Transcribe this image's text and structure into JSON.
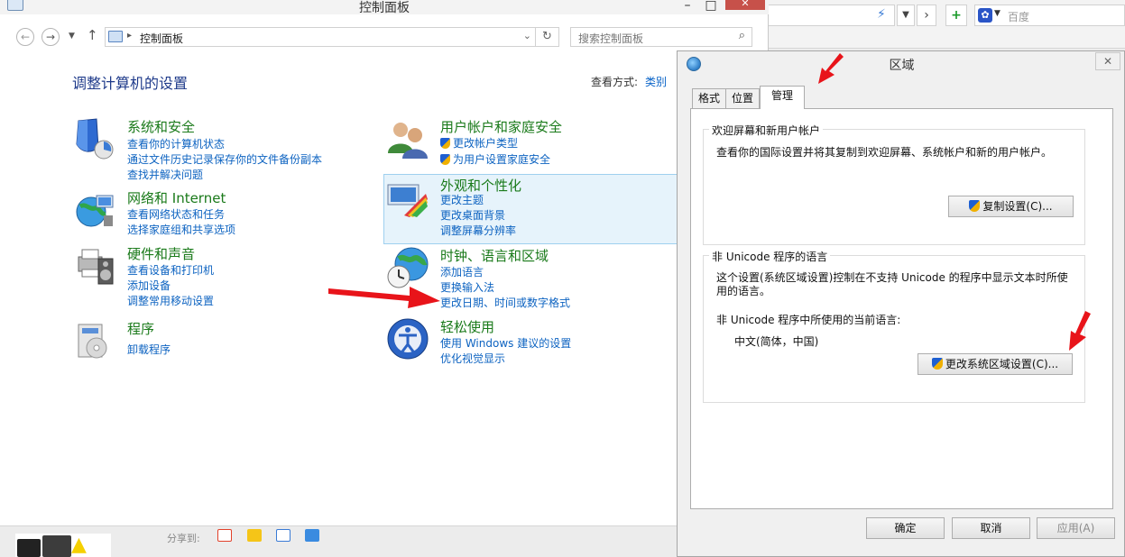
{
  "control_panel": {
    "title": "控制面板",
    "address": {
      "crumb": "控制面板",
      "separator": "▸"
    },
    "search_placeholder": "搜索控制面板",
    "heading": "调整计算机的设置",
    "view_by": {
      "label": "查看方式:",
      "value": "类别"
    },
    "categories": [
      {
        "title": "系统和安全",
        "links": [
          "查看你的计算机状态",
          "通过文件历史记录保存你的文件备份副本",
          "查找并解决问题"
        ]
      },
      {
        "title": "网络和 Internet",
        "links": [
          "查看网络状态和任务",
          "选择家庭组和共享选项"
        ]
      },
      {
        "title": "硬件和声音",
        "links": [
          "查看设备和打印机",
          "添加设备",
          "调整常用移动设置"
        ]
      },
      {
        "title": "程序",
        "links": [
          "卸载程序"
        ]
      },
      {
        "title": "用户帐户和家庭安全",
        "links": [
          "更改帐户类型",
          "为用户设置家庭安全"
        ]
      },
      {
        "title": "外观和个性化",
        "links": [
          "更改主题",
          "更改桌面背景",
          "调整屏幕分辨率"
        ]
      },
      {
        "title": "时钟、语言和区域",
        "links": [
          "添加语言",
          "更换输入法",
          "更改日期、时间或数字格式"
        ]
      },
      {
        "title": "轻松使用",
        "links": [
          "使用 Windows 建议的设置",
          "优化视觉显示"
        ]
      }
    ],
    "share_label": "分享到:"
  },
  "browser": {
    "search_placeholder": "百度"
  },
  "region_dialog": {
    "title": "区域",
    "tabs": [
      "格式",
      "位置",
      "管理"
    ],
    "active_tab": "管理",
    "welcome_group": {
      "label": "欢迎屏幕和新用户帐户",
      "text": "查看你的国际设置并将其复制到欢迎屏幕、系统帐户和新的用户帐户。",
      "button": "复制设置(C)..."
    },
    "unicode_group": {
      "label": "非 Unicode 程序的语言",
      "text_line1": "这个设置(系统区域设置)控制在不支持 Unicode 的程序中显示文本时所使",
      "text_line2": "用的语言。",
      "current_label": "非 Unicode 程序中所使用的当前语言:",
      "current_value": "中文(简体，中国)",
      "button": "更改系统区域设置(C)..."
    },
    "buttons": {
      "ok": "确定",
      "cancel": "取消",
      "apply": "应用(A)"
    }
  },
  "colors": {
    "category_title": "#1a7a1a",
    "link": "#0d63c1",
    "heading": "#1e3a8a",
    "annotation_arrow": "#e8141a"
  }
}
